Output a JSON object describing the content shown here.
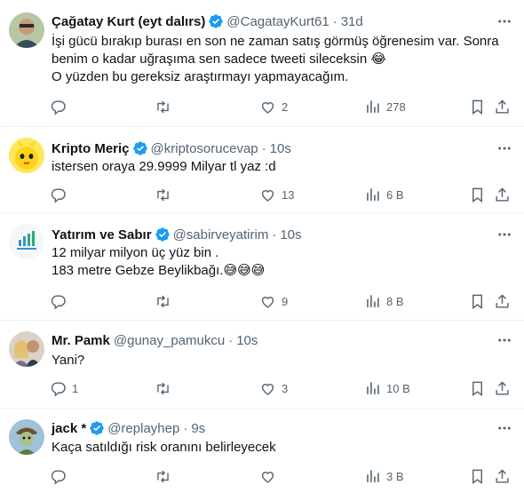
{
  "tweets": [
    {
      "name": "Çağatay Kurt (eyt dalırs)",
      "handle": "@CagatayKurt61",
      "time": "31d",
      "lines": [
        "İşi gücü bırakıp burası en son ne zaman satış görmüş öğrenesim var. Sonra",
        "benim o kadar uğraşıma sen sadece tweeti sileceksin",
        "O yüzden bu gereksiz araştırmayı yapmayacağım."
      ],
      "emoji": "😂",
      "replies": "",
      "retweets": "",
      "likes": "2",
      "views": "278"
    },
    {
      "name": "Kripto Meriç",
      "handle": "@kriptosorucevap",
      "time": "10s",
      "lines": [
        "istersen oraya 29.9999 Milyar tl yaz :d"
      ],
      "replies": "",
      "retweets": "",
      "likes": "13",
      "views": "6 B"
    },
    {
      "name": "Yatırım ve Sabır",
      "handle": "@sabirveyatirim",
      "time": "10s",
      "lines": [
        "12 milyar milyon üç yüz bin .",
        "183 metre Gebze Beylikbağı."
      ],
      "emoji": "😅😅😅",
      "replies": "",
      "retweets": "",
      "likes": "9",
      "views": "8 B"
    },
    {
      "name": "Mr. Pamk",
      "handle": "@gunay_pamukcu",
      "time": "10s",
      "lines": [
        "Yani?"
      ],
      "replies": "1",
      "retweets": "",
      "likes": "3",
      "views": "10 B"
    },
    {
      "name": "jack *",
      "handle": "@replayhep",
      "time": "9s",
      "lines": [
        "Kaça satıldığı risk oranını belirleyecek"
      ],
      "replies": "",
      "retweets": "",
      "likes": "",
      "views": "3 B"
    }
  ],
  "colors": {
    "verified": "#1d9bf0",
    "text": "#0f1419",
    "secondary": "#536471",
    "divider": "#eff3f4"
  },
  "icons": [
    "reply-icon",
    "retweet-icon",
    "like-icon",
    "views-icon",
    "bookmark-icon",
    "share-icon",
    "more-icon",
    "verified-icon"
  ]
}
